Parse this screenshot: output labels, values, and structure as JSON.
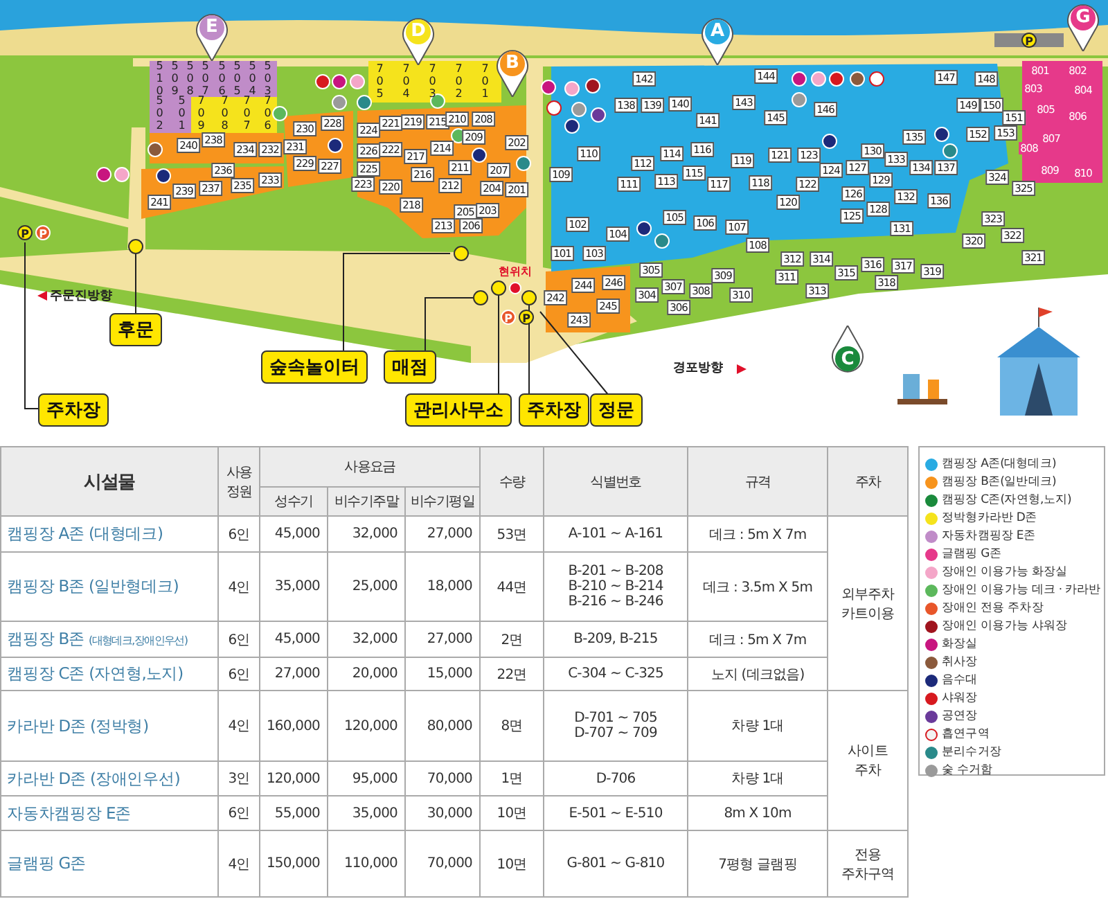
{
  "map": {
    "zones": [
      {
        "letter": "E",
        "color": "#c08cc8"
      },
      {
        "letter": "D",
        "color": "#f5e31c"
      },
      {
        "letter": "B",
        "color": "#f7941d"
      },
      {
        "letter": "A",
        "color": "#29abe2"
      },
      {
        "letter": "G",
        "color": "#e6398a"
      },
      {
        "letter": "C",
        "color": "#1a8a3c"
      }
    ],
    "sites": [
      {
        "number": "510",
        "kind": "autocamp"
      },
      {
        "number": "509",
        "kind": "autocamp"
      },
      {
        "number": "508",
        "kind": "autocamp"
      },
      {
        "number": "507",
        "kind": "autocamp"
      },
      {
        "number": "506",
        "kind": "autocamp"
      },
      {
        "number": "505",
        "kind": "autocamp"
      },
      {
        "number": "504",
        "kind": "autocamp"
      },
      {
        "number": "503",
        "kind": "autocamp"
      },
      {
        "number": "502",
        "kind": "autocamp"
      },
      {
        "number": "501",
        "kind": "autocamp"
      },
      {
        "number": "709",
        "kind": "caravan"
      },
      {
        "number": "708",
        "kind": "caravan"
      },
      {
        "number": "707",
        "kind": "caravan"
      },
      {
        "number": "706",
        "kind": "caravan"
      },
      {
        "number": "705",
        "kind": "caravan"
      },
      {
        "number": "704",
        "kind": "caravan"
      },
      {
        "number": "703",
        "kind": "caravan"
      },
      {
        "number": "702",
        "kind": "caravan"
      },
      {
        "number": "701",
        "kind": "caravan"
      },
      {
        "number": "230",
        "kind": "deck"
      },
      {
        "number": "228",
        "kind": "deck"
      },
      {
        "number": "224",
        "kind": "deck"
      },
      {
        "number": "221",
        "kind": "deck"
      },
      {
        "number": "219",
        "kind": "deck"
      },
      {
        "number": "215",
        "kind": "deck"
      },
      {
        "number": "210",
        "kind": "deck"
      },
      {
        "number": "208",
        "kind": "deck"
      },
      {
        "number": "240",
        "kind": "deck"
      },
      {
        "number": "238",
        "kind": "deck"
      },
      {
        "number": "234",
        "kind": "deck"
      },
      {
        "number": "232",
        "kind": "deck"
      },
      {
        "number": "231",
        "kind": "deck"
      },
      {
        "number": "226",
        "kind": "deck"
      },
      {
        "number": "222",
        "kind": "deck"
      },
      {
        "number": "217",
        "kind": "deck"
      },
      {
        "number": "214",
        "kind": "deck"
      },
      {
        "number": "209",
        "kind": "deck"
      },
      {
        "number": "202",
        "kind": "deck"
      },
      {
        "number": "236",
        "kind": "deck"
      },
      {
        "number": "233",
        "kind": "deck"
      },
      {
        "number": "229",
        "kind": "deck"
      },
      {
        "number": "227",
        "kind": "deck"
      },
      {
        "number": "225",
        "kind": "deck"
      },
      {
        "number": "216",
        "kind": "deck"
      },
      {
        "number": "211",
        "kind": "deck"
      },
      {
        "number": "207",
        "kind": "deck"
      },
      {
        "number": "239",
        "kind": "deck"
      },
      {
        "number": "237",
        "kind": "deck"
      },
      {
        "number": "235",
        "kind": "deck"
      },
      {
        "number": "241",
        "kind": "deck"
      },
      {
        "number": "223",
        "kind": "deck"
      },
      {
        "number": "220",
        "kind": "deck"
      },
      {
        "number": "212",
        "kind": "deck"
      },
      {
        "number": "204",
        "kind": "deck"
      },
      {
        "number": "201",
        "kind": "deck"
      },
      {
        "number": "218",
        "kind": "deck"
      },
      {
        "number": "205",
        "kind": "deck"
      },
      {
        "number": "203",
        "kind": "deck"
      },
      {
        "number": "213",
        "kind": "deck"
      },
      {
        "number": "206",
        "kind": "deck"
      },
      {
        "number": "244",
        "kind": "deck"
      },
      {
        "number": "246",
        "kind": "deck"
      },
      {
        "number": "242",
        "kind": "deck"
      },
      {
        "number": "245",
        "kind": "deck"
      },
      {
        "number": "243",
        "kind": "deck"
      },
      {
        "number": "142",
        "kind": "deck"
      },
      {
        "number": "138",
        "kind": "deck"
      },
      {
        "number": "139",
        "kind": "deck"
      },
      {
        "number": "140",
        "kind": "deck"
      },
      {
        "number": "141",
        "kind": "deck"
      },
      {
        "number": "144",
        "kind": "deck"
      },
      {
        "number": "143",
        "kind": "deck"
      },
      {
        "number": "145",
        "kind": "deck"
      },
      {
        "number": "146",
        "kind": "deck"
      },
      {
        "number": "110",
        "kind": "deck"
      },
      {
        "number": "109",
        "kind": "deck"
      },
      {
        "number": "112",
        "kind": "deck"
      },
      {
        "number": "114",
        "kind": "deck"
      },
      {
        "number": "116",
        "kind": "deck"
      },
      {
        "number": "111",
        "kind": "deck"
      },
      {
        "number": "113",
        "kind": "deck"
      },
      {
        "number": "115",
        "kind": "deck"
      },
      {
        "number": "117",
        "kind": "deck"
      },
      {
        "number": "119",
        "kind": "deck"
      },
      {
        "number": "121",
        "kind": "deck"
      },
      {
        "number": "123",
        "kind": "deck"
      },
      {
        "number": "124",
        "kind": "deck"
      },
      {
        "number": "127",
        "kind": "deck"
      },
      {
        "number": "130",
        "kind": "deck"
      },
      {
        "number": "133",
        "kind": "deck"
      },
      {
        "number": "135",
        "kind": "deck"
      },
      {
        "number": "134",
        "kind": "deck"
      },
      {
        "number": "137",
        "kind": "deck"
      },
      {
        "number": "118",
        "kind": "deck"
      },
      {
        "number": "122",
        "kind": "deck"
      },
      {
        "number": "129",
        "kind": "deck"
      },
      {
        "number": "120",
        "kind": "deck"
      },
      {
        "number": "126",
        "kind": "deck"
      },
      {
        "number": "132",
        "kind": "deck"
      },
      {
        "number": "136",
        "kind": "deck"
      },
      {
        "number": "125",
        "kind": "deck"
      },
      {
        "number": "128",
        "kind": "deck"
      },
      {
        "number": "131",
        "kind": "deck"
      },
      {
        "number": "102",
        "kind": "deck"
      },
      {
        "number": "104",
        "kind": "deck"
      },
      {
        "number": "105",
        "kind": "deck"
      },
      {
        "number": "106",
        "kind": "deck"
      },
      {
        "number": "107",
        "kind": "deck"
      },
      {
        "number": "108",
        "kind": "deck"
      },
      {
        "number": "101",
        "kind": "deck"
      },
      {
        "number": "103",
        "kind": "deck"
      },
      {
        "number": "147",
        "kind": "deck"
      },
      {
        "number": "148",
        "kind": "deck"
      },
      {
        "number": "149",
        "kind": "deck"
      },
      {
        "number": "150",
        "kind": "deck"
      },
      {
        "number": "151",
        "kind": "deck"
      },
      {
        "number": "152",
        "kind": "deck"
      },
      {
        "number": "153",
        "kind": "deck"
      },
      {
        "number": "801",
        "kind": "glamping"
      },
      {
        "number": "802",
        "kind": "glamping"
      },
      {
        "number": "803",
        "kind": "glamping"
      },
      {
        "number": "804",
        "kind": "glamping"
      },
      {
        "number": "805",
        "kind": "glamping"
      },
      {
        "number": "806",
        "kind": "glamping"
      },
      {
        "number": "807",
        "kind": "glamping"
      },
      {
        "number": "808",
        "kind": "glamping"
      },
      {
        "number": "809",
        "kind": "glamping"
      },
      {
        "number": "810",
        "kind": "glamping"
      },
      {
        "number": "324",
        "kind": "deck"
      },
      {
        "number": "325",
        "kind": "deck"
      },
      {
        "number": "323",
        "kind": "deck"
      },
      {
        "number": "320",
        "kind": "deck"
      },
      {
        "number": "322",
        "kind": "deck"
      },
      {
        "number": "321",
        "kind": "deck"
      },
      {
        "number": "305",
        "kind": "deck"
      },
      {
        "number": "309",
        "kind": "deck"
      },
      {
        "number": "304",
        "kind": "deck"
      },
      {
        "number": "307",
        "kind": "deck"
      },
      {
        "number": "308",
        "kind": "deck"
      },
      {
        "number": "306",
        "kind": "deck"
      },
      {
        "number": "310",
        "kind": "deck"
      },
      {
        "number": "312",
        "kind": "deck"
      },
      {
        "number": "314",
        "kind": "deck"
      },
      {
        "number": "311",
        "kind": "deck"
      },
      {
        "number": "315",
        "kind": "deck"
      },
      {
        "number": "313",
        "kind": "deck"
      },
      {
        "number": "316",
        "kind": "deck"
      },
      {
        "number": "317",
        "kind": "deck"
      },
      {
        "number": "318",
        "kind": "deck"
      },
      {
        "number": "319",
        "kind": "deck"
      }
    ],
    "places": [
      {
        "text": "후문"
      },
      {
        "text": "숲속놀이터"
      },
      {
        "text": "매점"
      },
      {
        "text": "주차장"
      },
      {
        "text": "관리사무소"
      },
      {
        "text": "주차장"
      },
      {
        "text": "정문"
      }
    ],
    "current_location": "현위치",
    "directions": [
      {
        "text": "주문진방향",
        "kind": "left"
      },
      {
        "text": "경포방향",
        "kind": "right"
      }
    ],
    "parking_signs": [
      {
        "text": "P",
        "kind": "general"
      },
      {
        "text": "P",
        "kind": "accessible"
      },
      {
        "text": "P",
        "kind": "general"
      },
      {
        "text": "P",
        "kind": "accessible"
      },
      {
        "text": "P",
        "kind": "general"
      }
    ]
  },
  "table": {
    "headers": {
      "facility": "시설물",
      "capacity": "사용 정원",
      "fee": "사용요금",
      "fee_columns": [
        "성수기",
        "비수기주말",
        "비수기평일"
      ],
      "quantity": "수량",
      "ids": "식별번호",
      "spec": "규격",
      "parking": "주차"
    },
    "rows": [
      {
        "zone": "캠핑장 A존",
        "note": "(대형데크)",
        "small_note": false,
        "capacity": "6인",
        "fees": [
          "45,000",
          "32,000",
          "27,000"
        ],
        "quantity": "53면",
        "ids": [
          "A-101 ~ A-161"
        ],
        "spec": "데크 : 5m X 7m",
        "parking": [
          "외부주차",
          "카트이용"
        ]
      },
      {
        "zone": "캠핑장 B존",
        "note": "(일반형데크)",
        "small_note": false,
        "capacity": "4인",
        "fees": [
          "35,000",
          "25,000",
          "18,000"
        ],
        "quantity": "44면",
        "ids": [
          "B-201 ~ B-208",
          "B-210 ~ B-214",
          "B-216 ~ B-246"
        ],
        "spec": "데크 : 3.5m X 5m"
      },
      {
        "zone": "캠핑장 B존",
        "note": "(대형데크,장애인우선)",
        "small_note": true,
        "capacity": "6인",
        "fees": [
          "45,000",
          "32,000",
          "27,000"
        ],
        "quantity": "2면",
        "ids": [
          "B-209, B-215"
        ],
        "spec": "데크 : 5m X 7m"
      },
      {
        "zone": "캠핑장 C존",
        "note": "(자연형,노지)",
        "small_note": false,
        "capacity": "6인",
        "fees": [
          "27,000",
          "20,000",
          "15,000"
        ],
        "quantity": "22면",
        "ids": [
          "C-304 ~ C-325"
        ],
        "spec": "노지 (데크없음)"
      },
      {
        "zone": "카라반 D존",
        "note": "(정박형)",
        "small_note": false,
        "capacity": "4인",
        "fees": [
          "160,000",
          "120,000",
          "80,000"
        ],
        "quantity": "8면",
        "ids": [
          "D-701 ~ 705",
          "D-707 ~ 709"
        ],
        "spec": "차량 1대",
        "parking": [
          "사이트",
          "주차"
        ]
      },
      {
        "zone": "카라반 D존",
        "note": "(장애인우선)",
        "small_note": false,
        "capacity": "3인",
        "fees": [
          "120,000",
          "95,000",
          "70,000"
        ],
        "quantity": "1면",
        "ids": [
          "D-706"
        ],
        "spec": "차량 1대"
      },
      {
        "zone": "자동차캠핑장 E존",
        "capacity": "6인",
        "fees": [
          "55,000",
          "35,000",
          "30,000"
        ],
        "quantity": "10면",
        "ids": [
          "E-501 ~ E-510"
        ],
        "spec": "8m X 10m"
      },
      {
        "zone": "글램핑 G존",
        "capacity": "4인",
        "fees": [
          "150,000",
          "110,000",
          "70,000"
        ],
        "quantity": "10면",
        "ids": [
          "G-801 ~ G-810"
        ],
        "spec": "7평형 글램핑",
        "parking": [
          "전용",
          "주차구역"
        ]
      }
    ]
  },
  "legend": [
    {
      "label": "캠핑장 A존(대형데크)",
      "color": "#29abe2"
    },
    {
      "label": "캠핑장 B존(일반데크)",
      "color": "#f7941d"
    },
    {
      "label": "캠핑장 C존(자연형,노지)",
      "color": "#1a8a3c"
    },
    {
      "label": "정박형카라반 D존",
      "color": "#f5e31c"
    },
    {
      "label": "자동차캠핑장 E존",
      "color": "#c08cc8"
    },
    {
      "label": "글램핑 G존",
      "color": "#e6398a"
    },
    {
      "label": "장애인 이용가능 화장실",
      "color": "#f4a6c8"
    },
    {
      "label": "장애인 이용가능 데크 · 카라반",
      "color": "#5cb85c"
    },
    {
      "label": "장애인 전용 주차장",
      "color": "#e8562a"
    },
    {
      "label": "장애인 이용가능 샤워장",
      "color": "#a0141e"
    },
    {
      "label": "화장실",
      "color": "#c8157f"
    },
    {
      "label": "취사장",
      "color": "#8b5a3c"
    },
    {
      "label": "음수대",
      "color": "#1c2a7a"
    },
    {
      "label": "샤워장",
      "color": "#d7191f"
    },
    {
      "label": "공연장",
      "color": "#6a3a9a"
    },
    {
      "label": "흡연구역",
      "color": "#f2f2f2"
    },
    {
      "label": "분리수거장",
      "color": "#2a8a8a"
    },
    {
      "label": "숯 수거함",
      "color": "#9a9a9a"
    }
  ]
}
